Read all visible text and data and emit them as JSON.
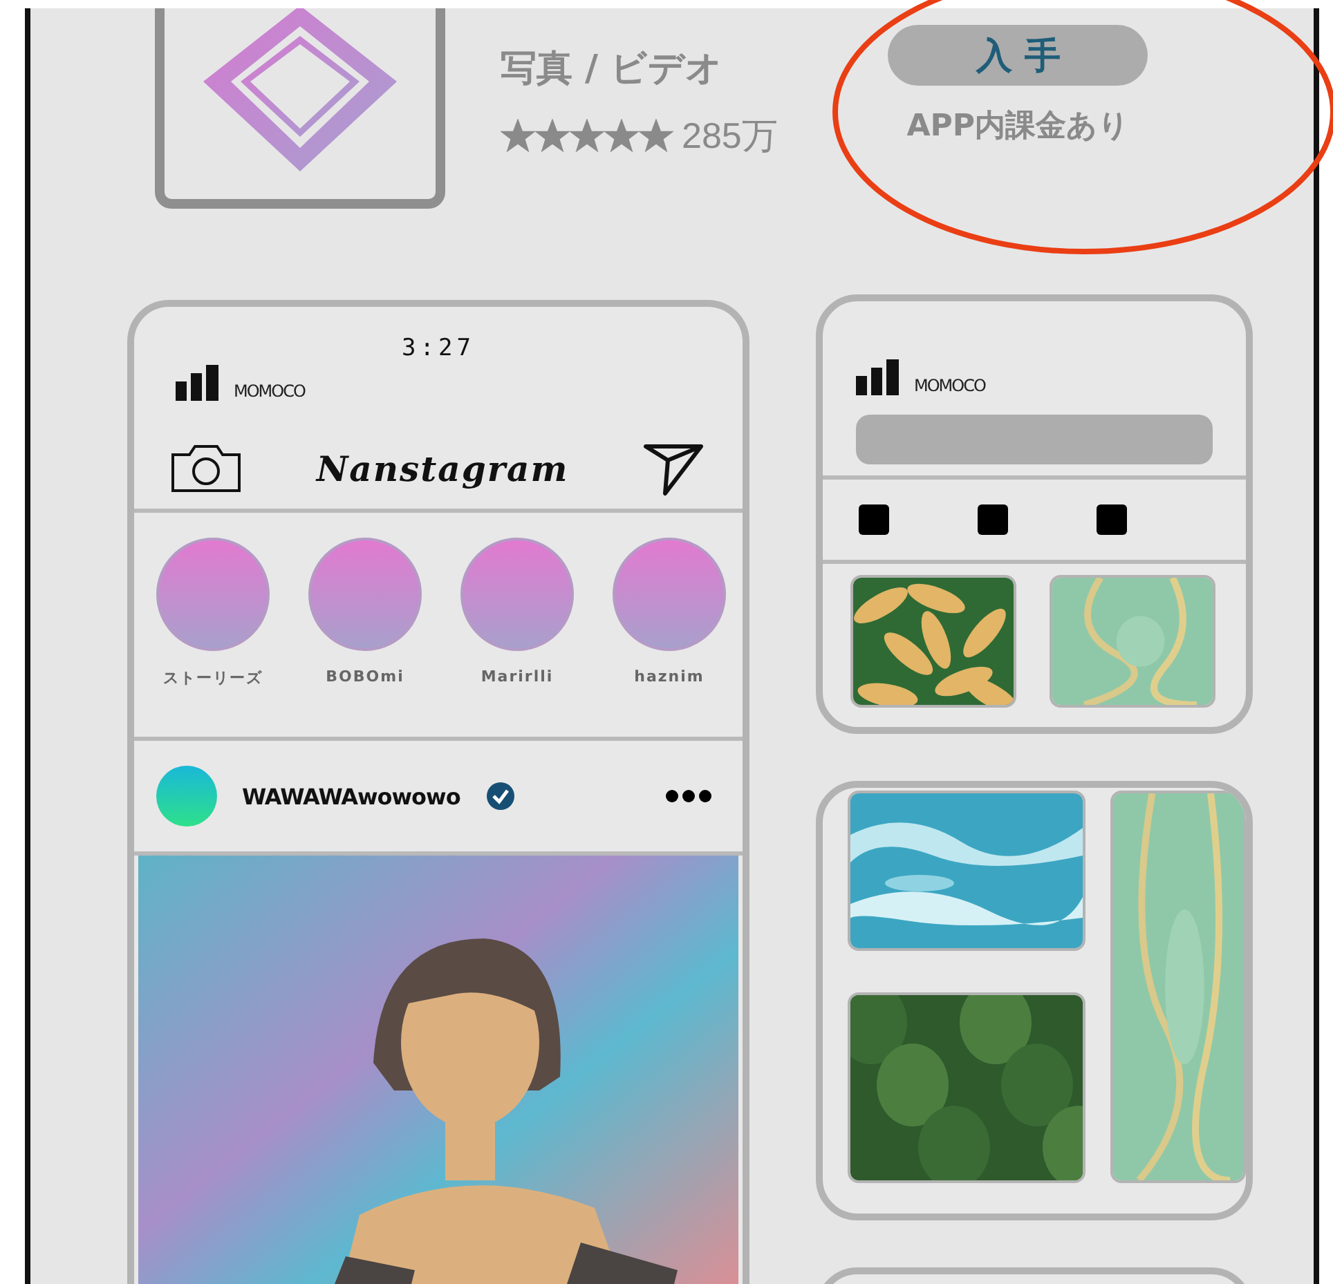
{
  "app": {
    "category": "写真 / ビデオ",
    "stars": 5,
    "rating_count": "285万",
    "get_button": "入 手",
    "note": "APP内課金あり"
  },
  "feed_phone": {
    "time": "3:27",
    "carrier": "MOMOCO",
    "logo": "Nanstagram",
    "stories": [
      {
        "name": "ストーリーズ"
      },
      {
        "name": "BOBOmi"
      },
      {
        "name": "Marirlli"
      },
      {
        "name": "haznim"
      }
    ],
    "post": {
      "user": "WAWAWAwowowo",
      "verified": true
    }
  },
  "search_phone": {
    "carrier": "MOMOCO"
  }
}
